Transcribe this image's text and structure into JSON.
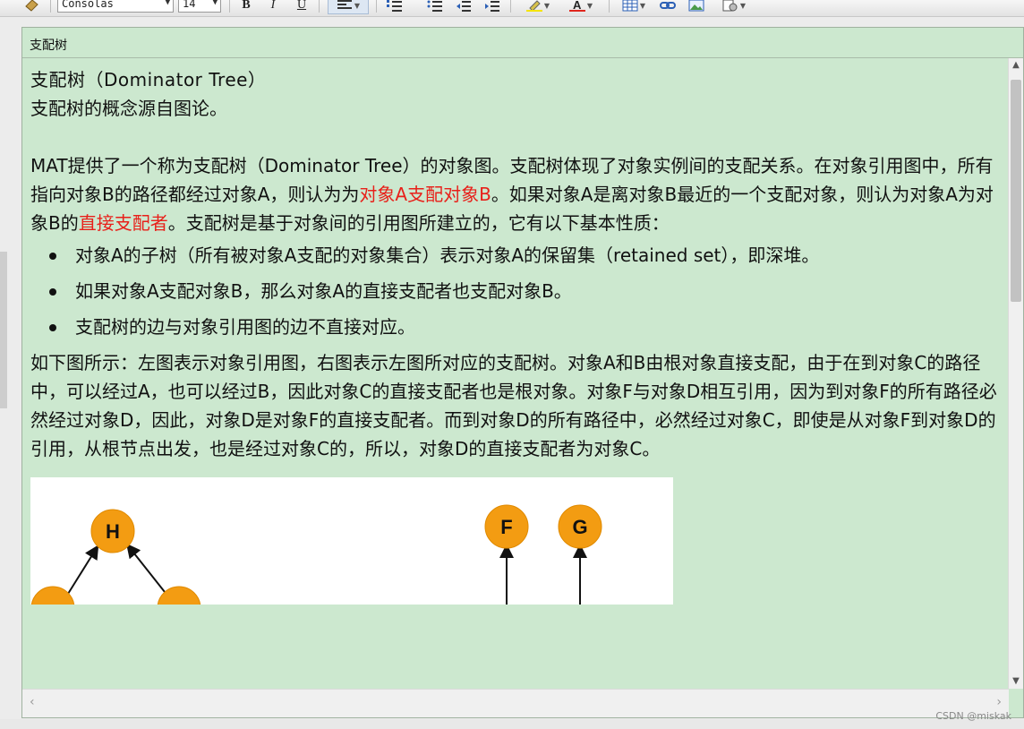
{
  "toolbar": {
    "font_name": "Consolas",
    "font_size": "14",
    "bold_label": "B",
    "italic_label": "I",
    "underline_label": "U"
  },
  "editor": {
    "title": "支配树"
  },
  "doc": {
    "heading": "支配树（Dominator Tree）",
    "intro": "支配树的概念源自图论。",
    "p1_a": "MAT提供了一个称为支配树（Dominator Tree）的对象图。支配树体现了对象实例间的支配关系。在对象引用图中，所有指向对象B的路径都经过对象A，则认为为",
    "p1_red1": "对象A支配对象B",
    "p1_b": "。如果对象A是离对象B最近的一个支配对象，则认为对象A为对象B的",
    "p1_red2": "直接支配者",
    "p1_c": "。支配树是基于对象间的引用图所建立的，它有以下基本性质：",
    "bullets": [
      "对象A的子树（所有被对象A支配的对象集合）表示对象A的保留集（retained set），即深堆。",
      "如果对象A支配对象B，那么对象A的直接支配者也支配对象B。",
      "支配树的边与对象引用图的边不直接对应。"
    ],
    "p2": "如下图所示：左图表示对象引用图，右图表示左图所对应的支配树。对象A和B由根对象直接支配，由于在到对象C的路径中，可以经过A，也可以经过B，因此对象C的直接支配者也是根对象。对象F与对象D相互引用，因为到对象F的所有路径必然经过对象D，因此，对象D是对象F的直接支配者。而到对象D的所有路径中，必然经过对象C，即使是从对象F到对象D的引用，从根节点出发，也是经过对象C的，所以，对象D的直接支配者为对象C。"
  },
  "figure": {
    "node_color": "#f39c12",
    "nodes": [
      "H",
      "F",
      "G"
    ]
  },
  "watermark": "CSDN @miskak"
}
